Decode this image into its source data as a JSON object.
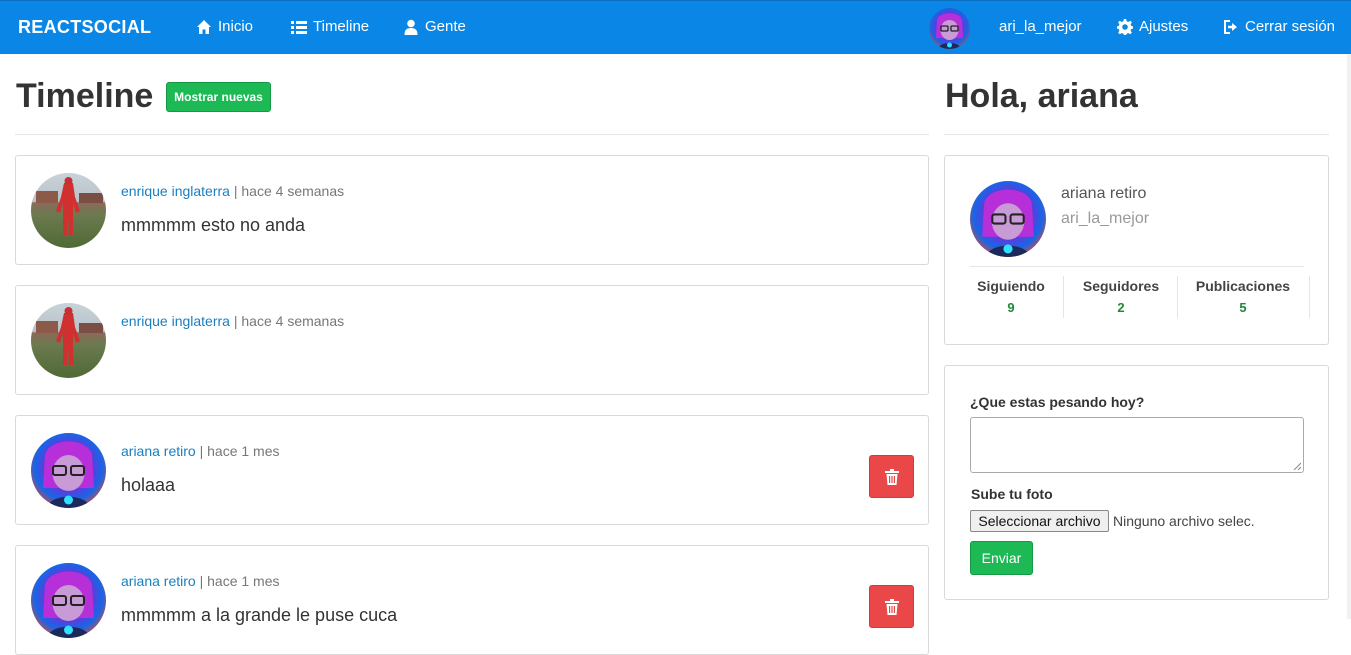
{
  "navbar": {
    "brand": "REACTSOCIAL",
    "links": [
      {
        "label": "Inicio",
        "icon": "home-icon"
      },
      {
        "label": "Timeline",
        "icon": "list-icon"
      },
      {
        "label": "Gente",
        "icon": "user-icon"
      }
    ],
    "username": "ari_la_mejor",
    "settings_label": "Ajustes",
    "logout_label": "Cerrar sesión"
  },
  "timeline": {
    "title": "Timeline",
    "show_new_label": "Mostrar nuevas",
    "posts": [
      {
        "author": "enrique inglaterra",
        "separator": "|",
        "time": "hace 4 semanas",
        "text": "mmmmm esto no anda",
        "deletable": false
      },
      {
        "author": "enrique inglaterra",
        "separator": "|",
        "time": "hace 4 semanas",
        "text": "",
        "deletable": false
      },
      {
        "author": "ariana retiro",
        "separator": "|",
        "time": "hace 1 mes",
        "text": "holaaa",
        "deletable": true
      },
      {
        "author": "ariana retiro",
        "separator": "|",
        "time": "hace 1 mes",
        "text": "mmmmm a la grande le puse cuca",
        "deletable": true
      }
    ]
  },
  "sidebar": {
    "greeting": "Hola, ariana",
    "profile": {
      "name": "ariana retiro",
      "username": "ari_la_mejor",
      "stats": [
        {
          "label": "Siguiendo",
          "value": "9"
        },
        {
          "label": "Seguidores",
          "value": "2"
        },
        {
          "label": "Publicaciones",
          "value": "5"
        }
      ]
    },
    "form": {
      "prompt_label": "¿Que estas pesando hoy?",
      "textarea_value": "",
      "photo_label": "Sube tu foto",
      "file_button_label": "Seleccionar archivo",
      "file_status": "Ninguno archivo selec.",
      "submit_label": "Enviar"
    }
  },
  "colors": {
    "navbar": "#0a87e6",
    "success": "#1db954",
    "danger": "#ea4848",
    "link": "#1a7fc0"
  }
}
